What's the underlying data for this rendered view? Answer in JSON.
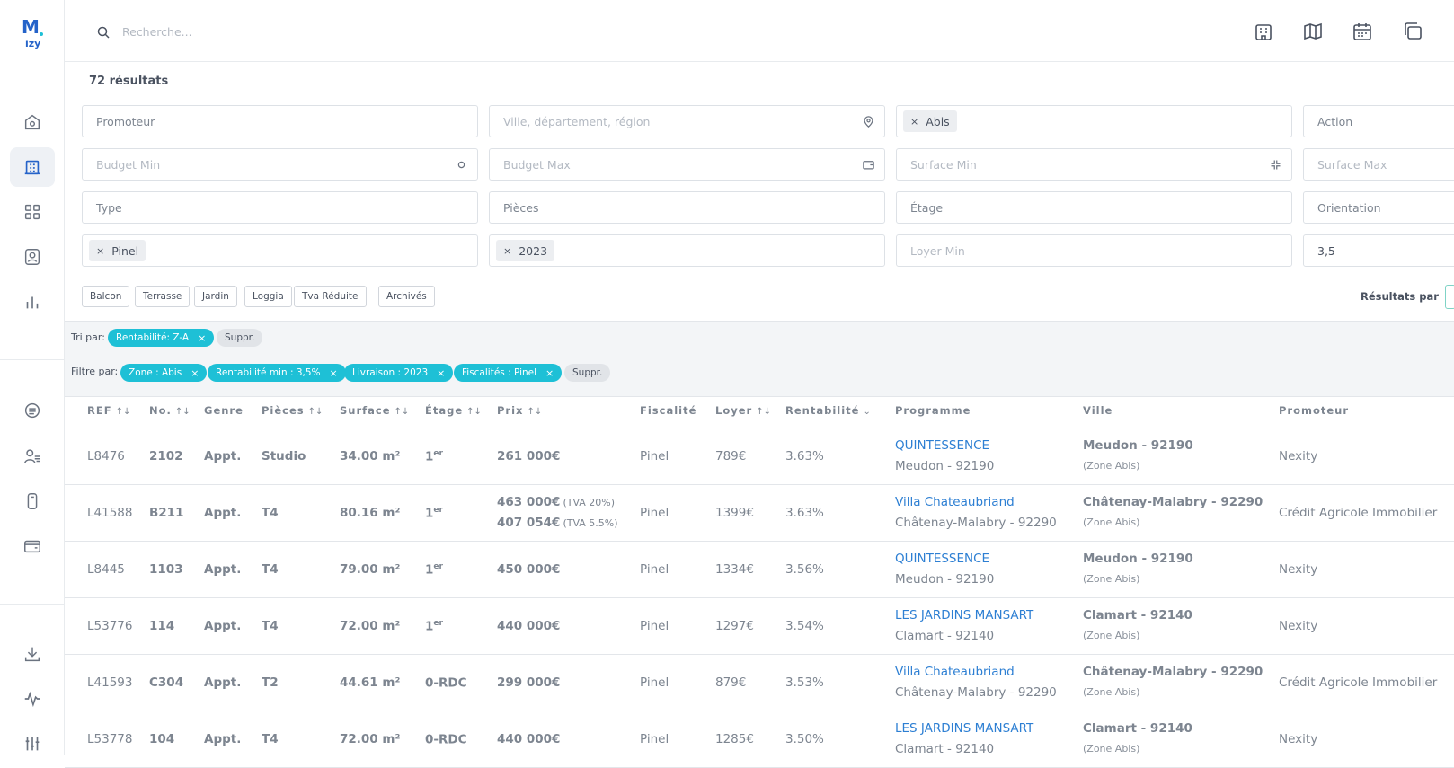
{
  "app": {
    "logo_text": "izy",
    "logo_letter": "M"
  },
  "search": {
    "placeholder": "Recherche..."
  },
  "results": {
    "count_label": "72 résultats"
  },
  "filters": {
    "promoteur": "Promoteur",
    "ville": "Ville, département, région",
    "zone_chip": "Abis",
    "action": "Action",
    "budget_min": "Budget Min",
    "budget_max": "Budget Max",
    "surface_min": "Surface Min",
    "surface_max": "Surface Max",
    "type": "Type",
    "pieces": "Pièces",
    "etage": "Étage",
    "orientation": "Orientation",
    "fiscalite_chip": "Pinel",
    "livraison_chip": "2023",
    "loyer_min": "Loyer Min",
    "rentabilite_value": "3,5"
  },
  "toggles": [
    "Balcon",
    "Terrasse",
    "Jardin",
    "Loggia",
    "Tva Réduite",
    "Archivés"
  ],
  "per_page_label": "Résultats par",
  "sort": {
    "label": "Tri par:",
    "tag": "Rentabilité: Z-A",
    "clear": "Suppr."
  },
  "filter_tags": {
    "label": "Filtre par:",
    "tags": [
      "Zone : Abis",
      "Rentabilité min : 3,5%",
      "Livraison : 2023",
      "Fiscalités : Pinel"
    ],
    "clear": "Suppr."
  },
  "columns": [
    "REF",
    "No.",
    "Genre",
    "Pièces",
    "Surface",
    "Étage",
    "Prix",
    "Fiscalité",
    "Loyer",
    "Rentabilité",
    "Programme",
    "Ville",
    "Promoteur"
  ],
  "sort_arrow": "↑↓",
  "sort_arrow_active": "⌄",
  "rows": [
    {
      "ref": "L8476",
      "no": "2102",
      "genre": "Appt.",
      "pieces": "Studio",
      "surface": "34.00 m²",
      "etage": "1",
      "etage_sup": "er",
      "prix": "261 000€",
      "prix_note": "",
      "prix2": "",
      "prix2_note": "",
      "fisc": "Pinel",
      "loyer": "789€",
      "rent": "3.63%",
      "prog": "QUINTESSENCE",
      "prog_city": "Meudon - 92190",
      "ville": "Meudon - 92190",
      "zone": "(Zone Abis)",
      "promoteur": "Nexity"
    },
    {
      "ref": "L41588",
      "no": "B211",
      "genre": "Appt.",
      "pieces": "T4",
      "surface": "80.16 m²",
      "etage": "1",
      "etage_sup": "er",
      "prix": "463 000€",
      "prix_note": "(TVA 20%)",
      "prix2": "407 054€",
      "prix2_note": "(TVA 5.5%)",
      "fisc": "Pinel",
      "loyer": "1399€",
      "rent": "3.63%",
      "prog": "Villa Chateaubriand",
      "prog_city": "Châtenay-Malabry - 92290",
      "ville": "Châtenay-Malabry - 92290",
      "zone": "(Zone Abis)",
      "promoteur": "Crédit Agricole Immobilier"
    },
    {
      "ref": "L8445",
      "no": "1103",
      "genre": "Appt.",
      "pieces": "T4",
      "surface": "79.00 m²",
      "etage": "1",
      "etage_sup": "er",
      "prix": "450 000€",
      "prix_note": "",
      "prix2": "",
      "prix2_note": "",
      "fisc": "Pinel",
      "loyer": "1334€",
      "rent": "3.56%",
      "prog": "QUINTESSENCE",
      "prog_city": "Meudon - 92190",
      "ville": "Meudon - 92190",
      "zone": "(Zone Abis)",
      "promoteur": "Nexity"
    },
    {
      "ref": "L53776",
      "no": "114",
      "genre": "Appt.",
      "pieces": "T4",
      "surface": "72.00 m²",
      "etage": "1",
      "etage_sup": "er",
      "prix": "440 000€",
      "prix_note": "",
      "prix2": "",
      "prix2_note": "",
      "fisc": "Pinel",
      "loyer": "1297€",
      "rent": "3.54%",
      "prog": "LES JARDINS MANSART",
      "prog_city": "Clamart - 92140",
      "ville": "Clamart - 92140",
      "zone": "(Zone Abis)",
      "promoteur": "Nexity"
    },
    {
      "ref": "L41593",
      "no": "C304",
      "genre": "Appt.",
      "pieces": "T2",
      "surface": "44.61 m²",
      "etage": "0-RDC",
      "etage_sup": "",
      "prix": "299 000€",
      "prix_note": "",
      "prix2": "",
      "prix2_note": "",
      "fisc": "Pinel",
      "loyer": "879€",
      "rent": "3.53%",
      "prog": "Villa Chateaubriand",
      "prog_city": "Châtenay-Malabry - 92290",
      "ville": "Châtenay-Malabry - 92290",
      "zone": "(Zone Abis)",
      "promoteur": "Crédit Agricole Immobilier"
    },
    {
      "ref": "L53778",
      "no": "104",
      "genre": "Appt.",
      "pieces": "T4",
      "surface": "72.00 m²",
      "etage": "0-RDC",
      "etage_sup": "",
      "prix": "440 000€",
      "prix_note": "",
      "prix2": "",
      "prix2_note": "",
      "fisc": "Pinel",
      "loyer": "1285€",
      "rent": "3.50%",
      "prog": "LES JARDINS MANSART",
      "prog_city": "Clamart - 92140",
      "ville": "Clamart - 92140",
      "zone": "(Zone Abis)",
      "promoteur": "Nexity"
    }
  ]
}
